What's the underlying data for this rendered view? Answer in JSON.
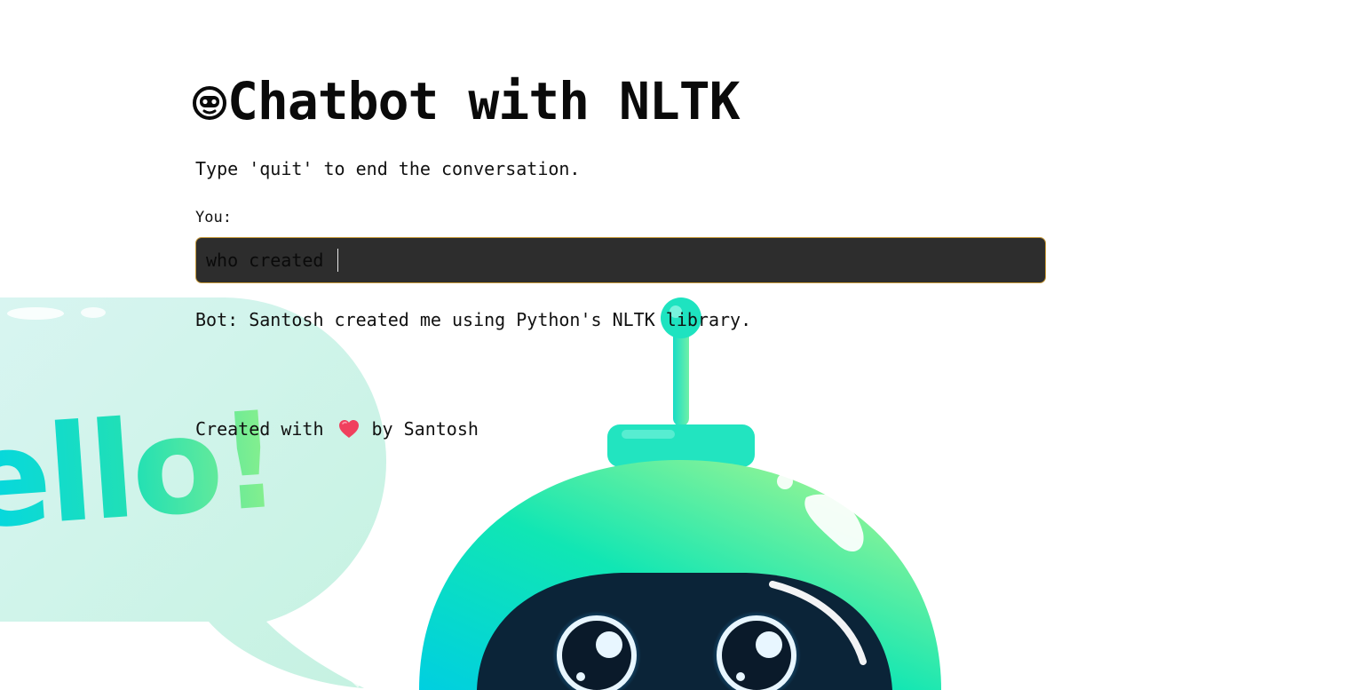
{
  "header": {
    "title": "Chatbot with NLTK",
    "title_icon": "robot-face-icon"
  },
  "instructions": "Type 'quit' to end the conversation.",
  "chat": {
    "input_label": "You:",
    "input_value": "who created ",
    "bot_response": "Bot: Santosh created me using Python's NLTK library."
  },
  "footer": {
    "prefix": "Created with",
    "icon": "heart-icon",
    "suffix": "by Santosh"
  },
  "background": {
    "bubble_text": "ello!",
    "theme_colors": {
      "teal": "#00d9d5",
      "mint": "#2ee8b2",
      "lime": "#c9f58a",
      "visor": "#0b2438",
      "input_bg": "#2d2d2d",
      "input_border": "#c79a3a",
      "heart": "#f0405e"
    }
  }
}
